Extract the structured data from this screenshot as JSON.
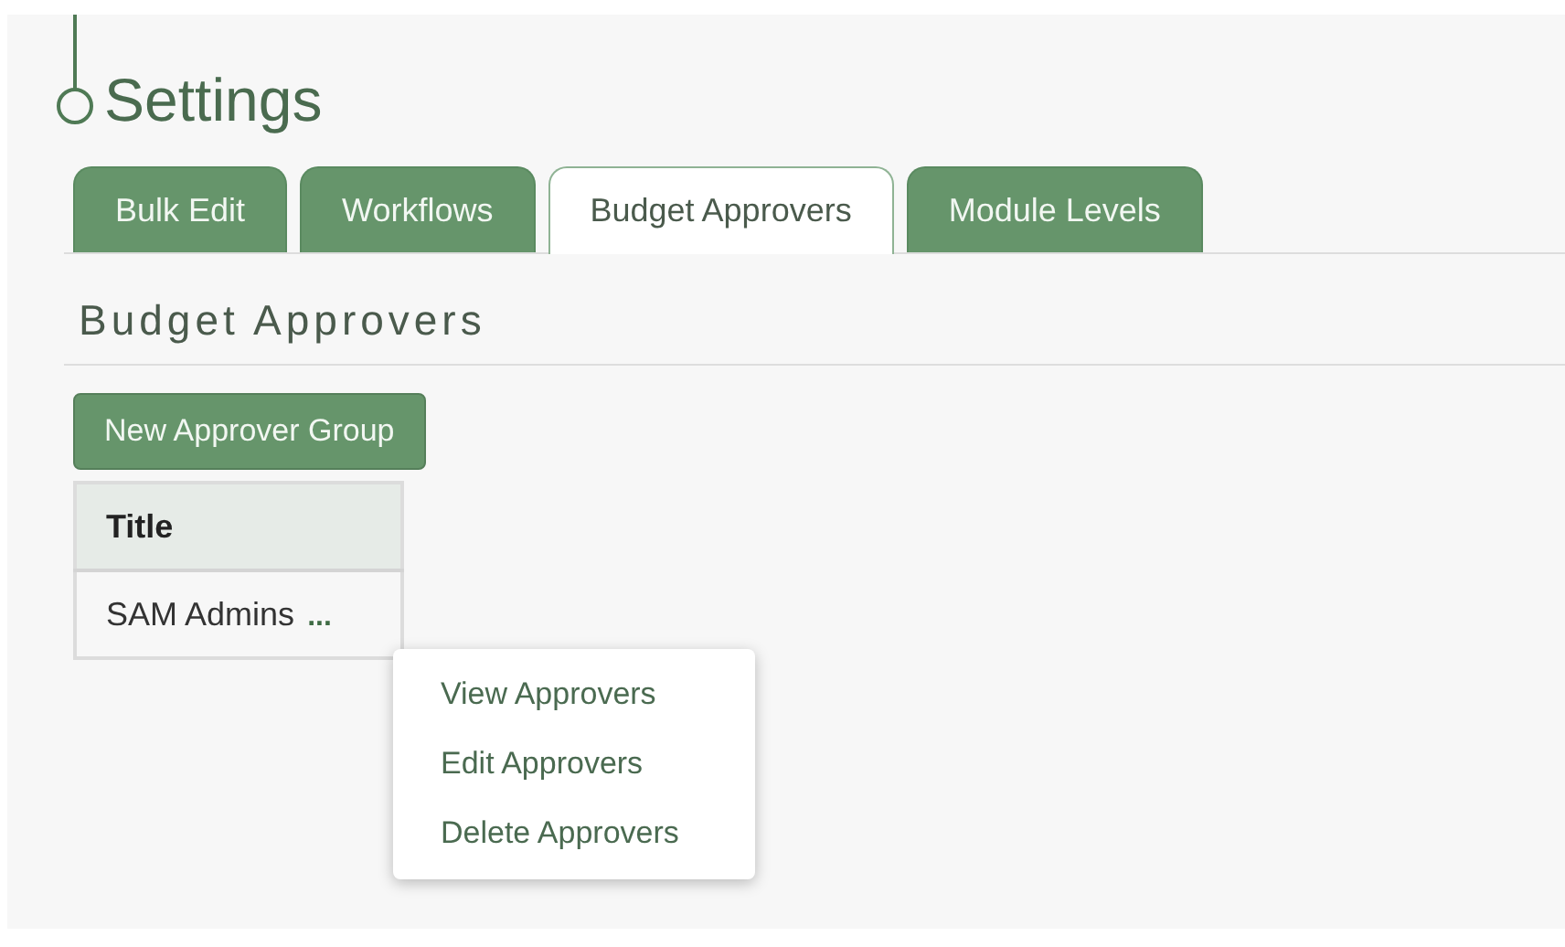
{
  "page_title": "Settings",
  "tabs": [
    {
      "label": "Bulk Edit",
      "selected": false
    },
    {
      "label": "Workflows",
      "selected": false
    },
    {
      "label": "Budget Approvers",
      "selected": true
    },
    {
      "label": "Module Levels",
      "selected": false
    }
  ],
  "section_heading": "Budget Approvers",
  "new_button": "New Approver Group",
  "table": {
    "columns": [
      "Title"
    ],
    "rows": [
      {
        "title": "SAM Admins",
        "actions": "..."
      }
    ]
  },
  "context_menu": {
    "items": [
      "View Approvers",
      "Edit Approvers",
      "Delete Approvers"
    ]
  }
}
